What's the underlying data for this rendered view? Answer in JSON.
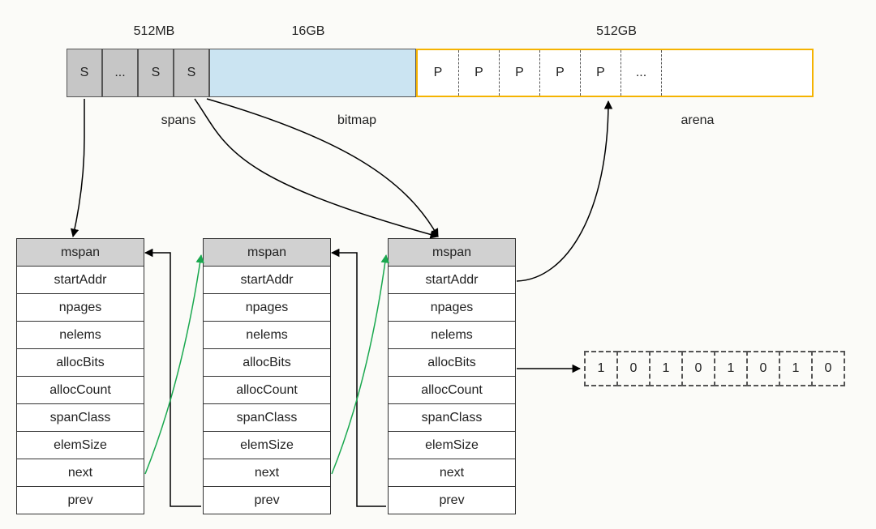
{
  "sizes": {
    "spans": "512MB",
    "bitmap": "16GB",
    "arena": "512GB"
  },
  "region_labels": {
    "spans": "spans",
    "bitmap": "bitmap",
    "arena": "arena"
  },
  "span_cells": [
    "S",
    "...",
    "S",
    "S"
  ],
  "arena_cells": [
    "P",
    "P",
    "P",
    "P",
    "P",
    "..."
  ],
  "mspan": {
    "header": "mspan",
    "fields": [
      "startAddr",
      "npages",
      "nelems",
      "allocBits",
      "allocCount",
      "spanClass",
      "elemSize",
      "next",
      "prev"
    ]
  },
  "alloc_bits": [
    "1",
    "0",
    "1",
    "0",
    "1",
    "0",
    "1",
    "0"
  ]
}
